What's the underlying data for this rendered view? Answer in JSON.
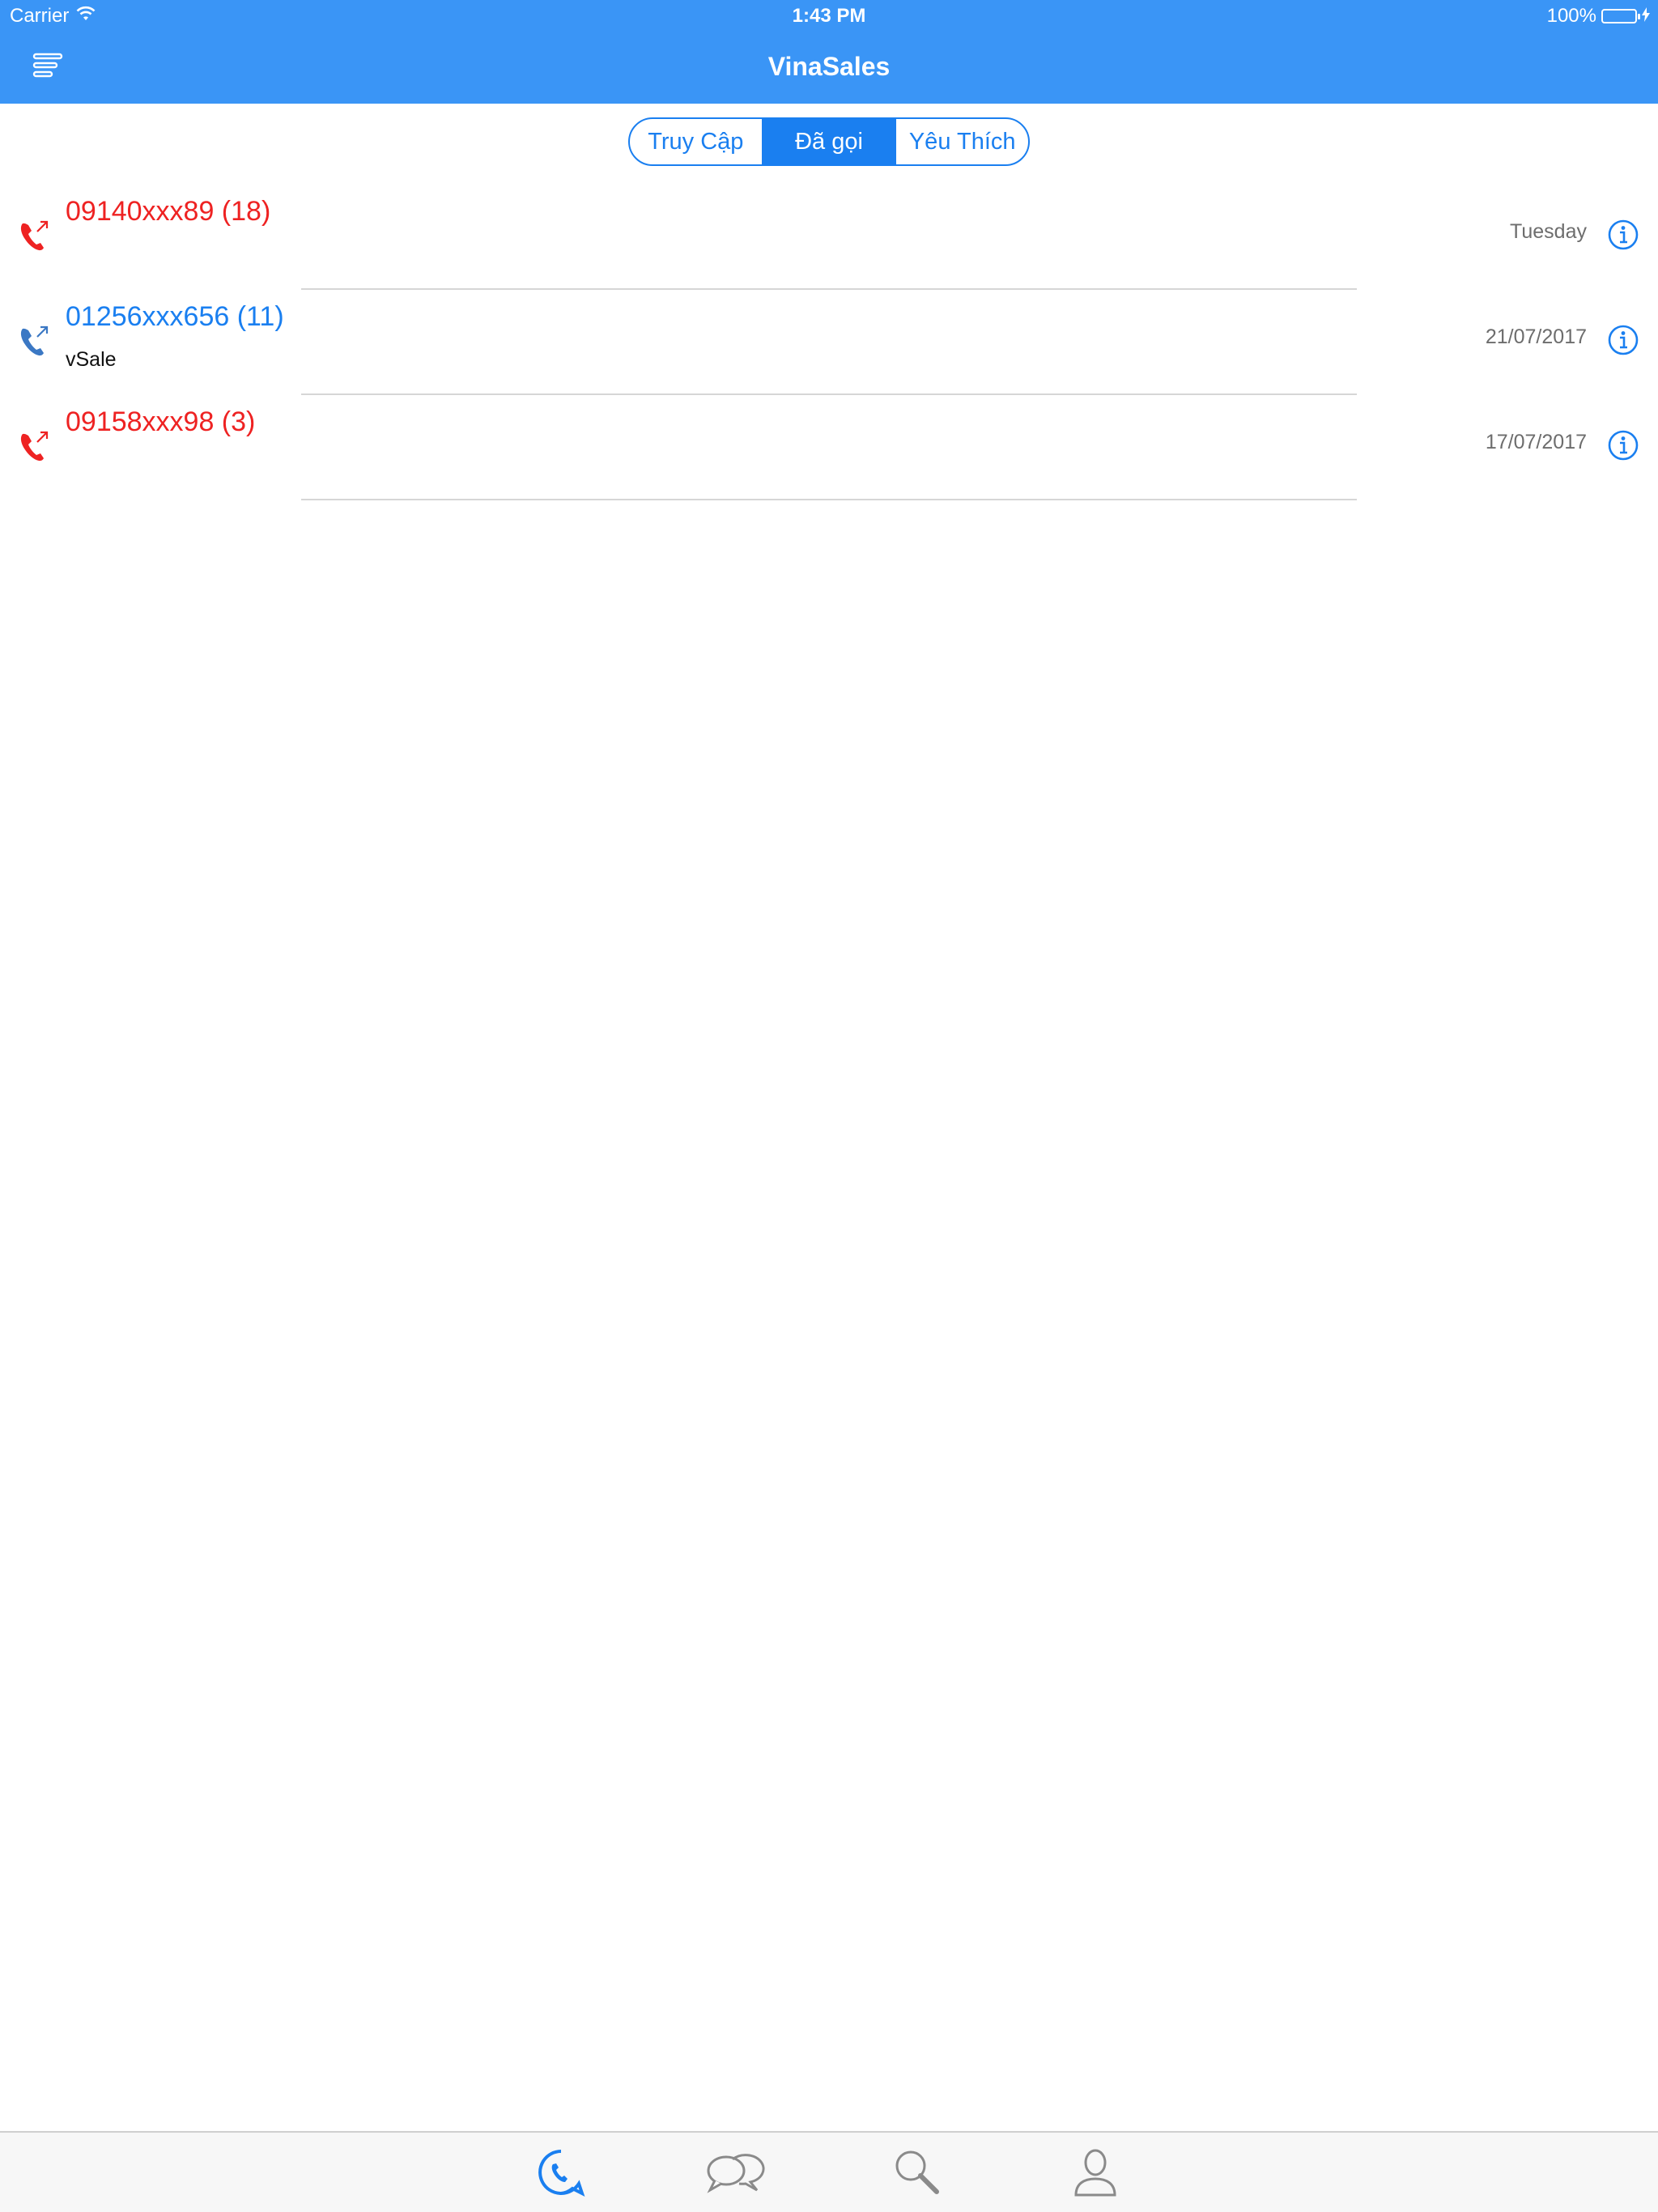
{
  "status_bar": {
    "carrier": "Carrier",
    "time": "1:43 PM",
    "battery": "100%"
  },
  "nav": {
    "title": "VinaSales",
    "menu_icon": "menu-lines-icon"
  },
  "segments": [
    {
      "label": "Truy Cập",
      "active": false
    },
    {
      "label": "Đã gọi",
      "active": true
    },
    {
      "label": "Yêu Thích",
      "active": false
    }
  ],
  "calls": [
    {
      "number": "09140xxx89 (18)",
      "subtitle": "",
      "date": "Tuesday",
      "color": "#ee2222"
    },
    {
      "number": "01256xxx656 (11)",
      "subtitle": "vSale",
      "date": "21/07/2017",
      "color": "#1a7ff0"
    },
    {
      "number": "09158xxx98 (3)",
      "subtitle": "",
      "date": "17/07/2017",
      "color": "#ee2222"
    }
  ],
  "tabbar": {
    "items": [
      {
        "icon": "call-history-icon",
        "active": true
      },
      {
        "icon": "chat-bubbles-icon",
        "active": false
      },
      {
        "icon": "search-icon",
        "active": false
      },
      {
        "icon": "user-profile-icon",
        "active": false
      }
    ]
  },
  "colors": {
    "nav_background": "#3a95f6",
    "accent": "#1a7ff0",
    "missed_red": "#ee2222",
    "outgoing_blue": "#3b78c4"
  }
}
